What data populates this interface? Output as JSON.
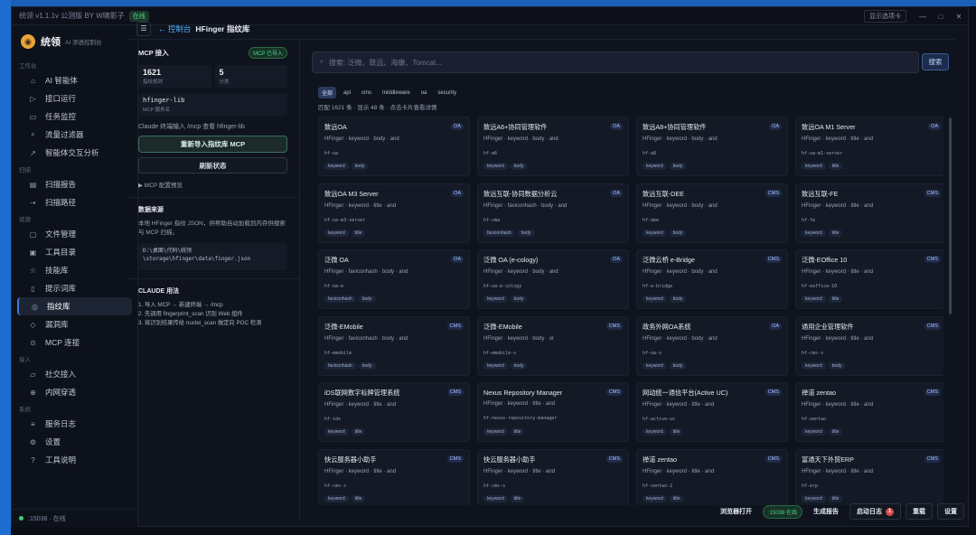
{
  "window": {
    "title": "统领 v1.1.1v 公测版 BY W啸影子",
    "status_badge": "在线",
    "display_window_label": "显示选项卡",
    "controls": [
      "—",
      "□",
      "✕"
    ]
  },
  "brand": {
    "name": "统领",
    "subtitle": "AI 渗透控制台"
  },
  "sidebar": {
    "sections": [
      {
        "label": "工作台",
        "items": [
          {
            "label": "AI 智能体",
            "icon": "robot-icon",
            "glyph": "⌂"
          },
          {
            "label": "接口运行",
            "icon": "play-icon",
            "glyph": "▷"
          },
          {
            "label": "任务监控",
            "icon": "monitor-icon",
            "glyph": "▭"
          },
          {
            "label": "流量过滤器",
            "icon": "filter-icon",
            "glyph": "⌕"
          },
          {
            "label": "智能体交互分析",
            "icon": "chart-icon",
            "glyph": "↗"
          }
        ]
      },
      {
        "label": "扫描",
        "items": [
          {
            "label": "扫描报告",
            "icon": "report-icon",
            "glyph": "▤"
          },
          {
            "label": "扫描路径",
            "icon": "path-icon",
            "glyph": "⇢"
          }
        ]
      },
      {
        "label": "资源",
        "items": [
          {
            "label": "文件管理",
            "icon": "folder-icon",
            "glyph": "▢"
          },
          {
            "label": "工具目录",
            "icon": "toolbox-icon",
            "glyph": "▣"
          },
          {
            "label": "技能库",
            "icon": "star-icon",
            "glyph": "☆"
          },
          {
            "label": "提示词库",
            "icon": "doc-icon",
            "glyph": "▯"
          },
          {
            "label": "指纹库",
            "icon": "fingerprint-icon",
            "glyph": "◎",
            "active": true
          },
          {
            "label": "漏洞库",
            "icon": "shield-icon",
            "glyph": "◇"
          },
          {
            "label": "MCP 连接",
            "icon": "plug-icon",
            "glyph": "⊙"
          }
        ]
      },
      {
        "label": "接入",
        "items": [
          {
            "label": "社交接入",
            "icon": "chat-icon",
            "glyph": "▱"
          },
          {
            "label": "内网穿透",
            "icon": "tunnel-icon",
            "glyph": "⊕"
          }
        ]
      },
      {
        "label": "系统",
        "items": [
          {
            "label": "服务日志",
            "icon": "log-icon",
            "glyph": "≡"
          },
          {
            "label": "设置",
            "icon": "gear-icon",
            "glyph": "⚙"
          },
          {
            "label": "工具说明",
            "icon": "help-icon",
            "glyph": "?"
          }
        ]
      }
    ],
    "footer": ":15038 · 在线"
  },
  "header": {
    "menu_glyph": "☰",
    "back": "← 控制台",
    "title": "HFinger 指纹库"
  },
  "left_panel": {
    "title": "MCP 接入",
    "mcp_badge": "MCP 已导入",
    "stats": [
      {
        "value": "1621",
        "label": "指纹规则"
      },
      {
        "value": "5",
        "label": "分类"
      }
    ],
    "lib": {
      "value": "hfinger-lib",
      "label": "MCP 服务名"
    },
    "hint": "Claude 终端输入 /mcp 查看 hfinger-lib",
    "btn_reimport": "重新导入指纹库 MCP",
    "btn_refresh": "刷新状态",
    "mcp_config": "▶ MCP 配置预览",
    "data_title": "数据来源",
    "data_desc": "本地 HFinger 指纹 JSON，供帮助自动加载到内存供搜索与 MCP 扫描。",
    "data_path": "D:\\桌面\\代码\\统领\\storage\\hfinger\\data\\finger.json",
    "claude_title": "CLAUDE 用法",
    "claude_steps": [
      "1. 导入 MCP → 新建终端 → /mcp",
      "2. 先调用 fingerprint_scan 识别 Web 组件",
      "3. 将识别结果传给 nuclei_scan 做定向 POC 检测"
    ]
  },
  "search": {
    "placeholder": "搜索: 泛微、致远、海康、Tomcat...",
    "button": "搜索",
    "icon": "⌕"
  },
  "filters": [
    "全部",
    "api",
    "cms",
    "middleware",
    "oa",
    "security"
  ],
  "count_line": "匹配 1621 条 · 显示 48 条 · 点击卡片查看详情",
  "cards": [
    {
      "title": "致远OA",
      "tag": "OA",
      "desc": "HFinger · keyword · body · and",
      "path": "hf-oa",
      "kw": [
        "keyword",
        "body"
      ]
    },
    {
      "title": "致远A6+协同管理软件",
      "tag": "OA",
      "desc": "HFinger · keyword · body · and",
      "path": "hf-a6",
      "kw": [
        "keyword",
        "body"
      ]
    },
    {
      "title": "致远A8+协同管理软件",
      "tag": "OA",
      "desc": "HFinger · keyword · body · and",
      "path": "hf-a8",
      "kw": [
        "keyword",
        "body"
      ]
    },
    {
      "title": "致远OA M1 Server",
      "tag": "OA",
      "desc": "HFinger · keyword · title · and",
      "path": "hf-oa-m1-server",
      "kw": [
        "keyword",
        "title"
      ]
    },
    {
      "title": "致远OA M3 Server",
      "tag": "OA",
      "desc": "HFinger · keyword · title · and",
      "path": "hf-oa-m3-server",
      "kw": [
        "keyword",
        "title"
      ]
    },
    {
      "title": "致远互联-协同数据分析云",
      "tag": "OA",
      "desc": "HFinger · faviconhash · body · and",
      "path": "hf-cma",
      "kw": [
        "faviconhash",
        "body"
      ]
    },
    {
      "title": "致远互联-DEE",
      "tag": "CMS",
      "desc": "HFinger · keyword · body · and",
      "path": "hf-dee",
      "kw": [
        "keyword",
        "body"
      ]
    },
    {
      "title": "致远互联-FE",
      "tag": "CMS",
      "desc": "HFinger · keyword · title · and",
      "path": "hf-fe",
      "kw": [
        "keyword",
        "title"
      ]
    },
    {
      "title": "泛微 OA",
      "tag": "OA",
      "desc": "HFinger · faviconhash · body · and",
      "path": "hf-oa-e",
      "kw": [
        "faviconhash",
        "body"
      ]
    },
    {
      "title": "泛微 OA (e-cology)",
      "tag": "OA",
      "desc": "HFinger · keyword · body · and",
      "path": "hf-oa-e-cology",
      "kw": [
        "keyword",
        "body"
      ]
    },
    {
      "title": "泛微云桥 e-Bridge",
      "tag": "CMS",
      "desc": "HFinger · keyword · body · and",
      "path": "hf-e-bridge",
      "kw": [
        "keyword",
        "body"
      ]
    },
    {
      "title": "泛微-EOffice 10",
      "tag": "CMS",
      "desc": "HFinger · keyword · title · and",
      "path": "hf-eoffice-10",
      "kw": [
        "keyword",
        "title"
      ]
    },
    {
      "title": "泛微-EMobile",
      "tag": "CMS",
      "desc": "HFinger · faviconhash · body · and",
      "path": "hf-emobile",
      "kw": [
        "faviconhash",
        "body"
      ]
    },
    {
      "title": "泛微-EMobile",
      "tag": "CMS",
      "desc": "HFinger · keyword · body · or",
      "path": "hf-emobile-s",
      "kw": [
        "keyword",
        "body"
      ]
    },
    {
      "title": "政务外网OA系统",
      "tag": "OA",
      "desc": "HFinger · keyword · body · and",
      "path": "hf-oa-s",
      "kw": [
        "keyword",
        "body"
      ]
    },
    {
      "title": "通用企业管理软件",
      "tag": "CMS",
      "desc": "HFinger · keyword · title · and",
      "path": "hf-cms-s",
      "kw": [
        "keyword",
        "body"
      ]
    },
    {
      "title": "iDS联网数字标牌管理系统",
      "tag": "CMS",
      "desc": "HFinger · keyword · title · and",
      "path": "hf-ids",
      "kw": [
        "keyword",
        "title"
      ]
    },
    {
      "title": "Nexus Repository Manager",
      "tag": "CMS",
      "desc": "HFinger · keyword · title · and",
      "path": "hf-nexus-repository-manager",
      "kw": [
        "keyword",
        "title"
      ]
    },
    {
      "title": "网动统一通信平台(Active UC)",
      "tag": "CMS",
      "desc": "HFinger · keyword · title · and",
      "path": "hf-active-uc",
      "kw": [
        "keyword",
        "title"
      ]
    },
    {
      "title": "禅道 zentao",
      "tag": "CMS",
      "desc": "HFinger · keyword · title · and",
      "path": "hf-zentao",
      "kw": [
        "keyword",
        "title"
      ]
    },
    {
      "title": "快云服务器小助手",
      "tag": "CMS",
      "desc": "HFinger · keyword · title · and",
      "path": "hf-cms-s",
      "kw": [
        "keyword",
        "title"
      ]
    },
    {
      "title": "快云服务器小助手",
      "tag": "CMS",
      "desc": "HFinger · keyword · title · and",
      "path": "hf-cms-s",
      "kw": [
        "keyword",
        "title"
      ]
    },
    {
      "title": "禅道 zentao",
      "tag": "CMS",
      "desc": "HFinger · keyword · title · and",
      "path": "hf-zentao-2",
      "kw": [
        "keyword",
        "title"
      ]
    },
    {
      "title": "富通天下外贸ERP",
      "tag": "CMS",
      "desc": "HFinger · keyword · title · and",
      "path": "hf-erp",
      "kw": [
        "keyword",
        "title"
      ]
    }
  ],
  "bottom_bar": {
    "open_browser": "浏览器打开",
    "status": ":15038 在线",
    "report": "生成报告",
    "start_log": "启动日志",
    "log_badge": "1",
    "restart": "重载",
    "settings": "设置"
  }
}
